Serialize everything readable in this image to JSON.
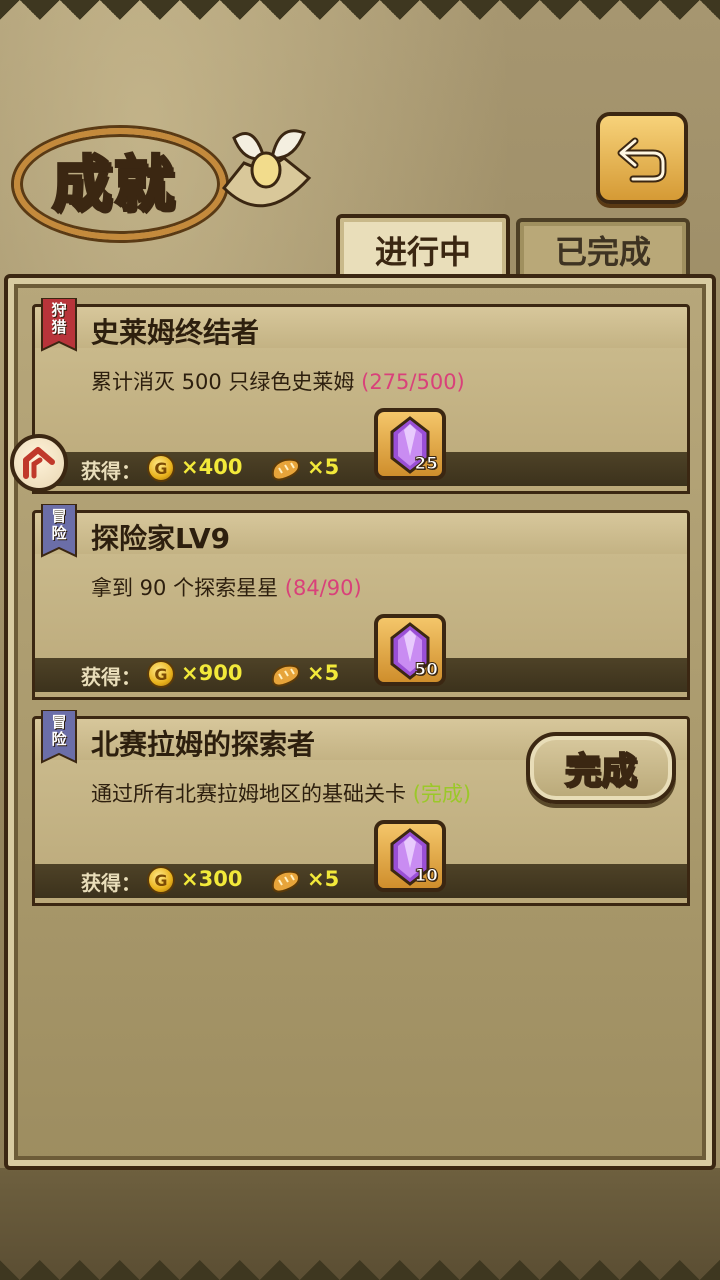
{
  "header": {
    "title": "成就",
    "back_icon": "back-arrow-icon"
  },
  "tabs": [
    {
      "label": "进行中",
      "active": true
    },
    {
      "label": "已完成",
      "active": false
    }
  ],
  "achievements": [
    {
      "category": "狩猎",
      "category_color": "#b8343a",
      "title": "史莱姆终结者",
      "desc": "累计消灭 500 只绿色史莱姆",
      "progress": "(275/500)",
      "reward_label": "获得：",
      "coin_icon": "G",
      "coins": "×400",
      "bread": "×5",
      "gems": "25"
    },
    {
      "category": "冒险",
      "category_color": "#6b6ea8",
      "title": "探险家LV9",
      "desc": "拿到 90 个探索星星",
      "progress": "(84/90)",
      "reward_label": "获得：",
      "coin_icon": "G",
      "coins": "×900",
      "bread": "×5",
      "gems": "50"
    },
    {
      "category": "冒险",
      "category_color": "#6b6ea8",
      "title": "北赛拉姆的探索者",
      "desc": "通过所有北赛拉姆地区的基础关卡",
      "progress": "(完成)",
      "reward_label": "获得：",
      "coin_icon": "G",
      "coins": "×300",
      "bread": "×5",
      "gems": "10"
    }
  ],
  "complete_button": "完成"
}
